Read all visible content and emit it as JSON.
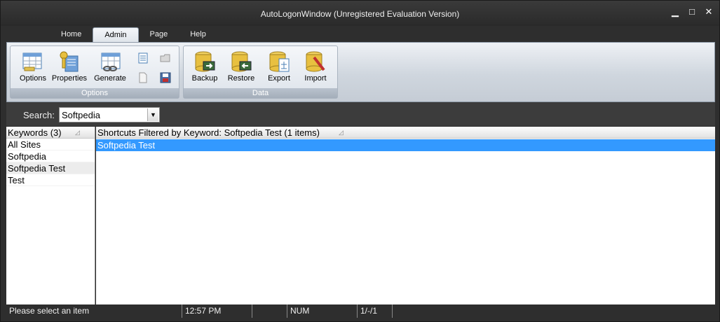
{
  "window": {
    "title": "AutoLogonWindow  (Unregistered Evaluation Version)",
    "min": "▁",
    "max": "□",
    "close": "✕"
  },
  "tabs": [
    "Home",
    "Admin",
    "Page",
    "Help"
  ],
  "active_tab": "Admin",
  "ribbon": {
    "options_group": {
      "label": "Options",
      "buttons": [
        "Options",
        "Properties",
        "Generate"
      ]
    },
    "data_group": {
      "label": "Data",
      "buttons": [
        "Backup",
        "Restore",
        "Export",
        "Import"
      ]
    }
  },
  "search": {
    "label": "Search:",
    "value": "Softpedia"
  },
  "keywords": {
    "header": "Keywords (3)",
    "items": [
      "All Sites",
      "Softpedia",
      "Softpedia Test",
      "Test"
    ],
    "selected": "Softpedia Test"
  },
  "shortcuts": {
    "header": "Shortcuts Filtered by Keyword: Softpedia Test (1 items)",
    "items": [
      "Softpedia Test"
    ]
  },
  "statusbar": {
    "message": "Please select an item",
    "time": "12:57 PM",
    "num": "NUM",
    "page": "1/-/1"
  }
}
